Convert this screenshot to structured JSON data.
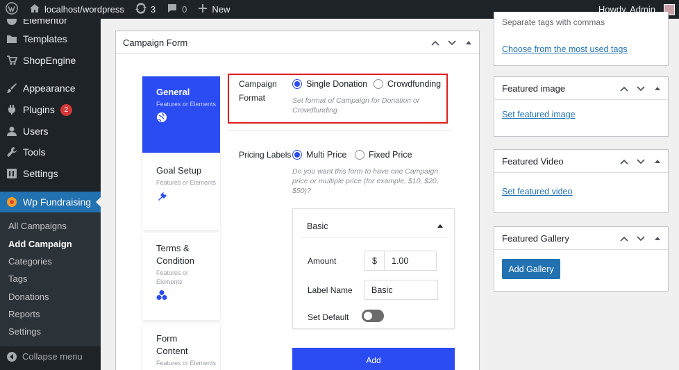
{
  "adminbar": {
    "site": "localhost/wordpress",
    "updates": "3",
    "comments": "0",
    "new_label": "New",
    "howdy": "Howdy, Admin"
  },
  "sidebar": {
    "items": [
      {
        "label": "Elementor",
        "icon": "elementor-icon"
      },
      {
        "label": "Templates",
        "icon": "folder-icon"
      },
      {
        "label": "ShopEngine",
        "icon": "cart-icon"
      },
      {
        "label": "Appearance",
        "icon": "brush-icon"
      },
      {
        "label": "Plugins",
        "icon": "plug-icon",
        "badge": "2"
      },
      {
        "label": "Users",
        "icon": "user-icon"
      },
      {
        "label": "Tools",
        "icon": "wrench-icon"
      },
      {
        "label": "Settings",
        "icon": "settings-icon"
      },
      {
        "label": "Wp Fundraising",
        "icon": "fundraising-icon"
      }
    ],
    "submenu": [
      "All Campaigns",
      "Add Campaign",
      "Categories",
      "Tags",
      "Donations",
      "Reports",
      "Settings"
    ],
    "collapse_label": "Collapse menu"
  },
  "campaign_form": {
    "title": "Campaign Form",
    "tabs": [
      {
        "title": "General",
        "sub": "Features or Elements"
      },
      {
        "title": "Goal Setup",
        "sub": "Features or Elements"
      },
      {
        "title": "Terms & Condition",
        "sub": "Features or Elements"
      },
      {
        "title": "Form Content",
        "sub": "Features or Elements"
      }
    ],
    "campaign_format": {
      "label_line1": "Campaign",
      "label_line2": "Format",
      "option1": "Single Donation",
      "option2": "Crowdfunding",
      "selected": "Single Donation",
      "help": "Set format of Campaign for Donation or Crowdfunding"
    },
    "pricing_labels": {
      "label": "Pricing Labels",
      "option1": "Multi Price",
      "option2": "Fixed Price",
      "selected": "Multi Price",
      "help": "Do you want this form to have one Campaign price or multiple price (for example, $10, $20, $50)?"
    },
    "price_item": {
      "title": "Basic",
      "amount_label": "Amount",
      "currency": "$",
      "amount": "1.00",
      "label_name_label": "Label Name",
      "label_name": "Basic",
      "set_default_label": "Set Default"
    },
    "add_button": "Add"
  },
  "right": {
    "tags_help": "Separate tags with commas",
    "tags_link": "Choose from the most used tags",
    "featured_image": {
      "title": "Featured image",
      "link": "Set featured image"
    },
    "featured_video": {
      "title": "Featured Video",
      "link": "Set featured video"
    },
    "featured_gallery": {
      "title": "Featured Gallery",
      "button": "Add Gallery"
    }
  },
  "colors": {
    "admin_dark": "#1d2327",
    "wp_blue": "#2271b1",
    "accent_blue": "#2b4cf3",
    "highlight_red": "#e11d1d"
  }
}
